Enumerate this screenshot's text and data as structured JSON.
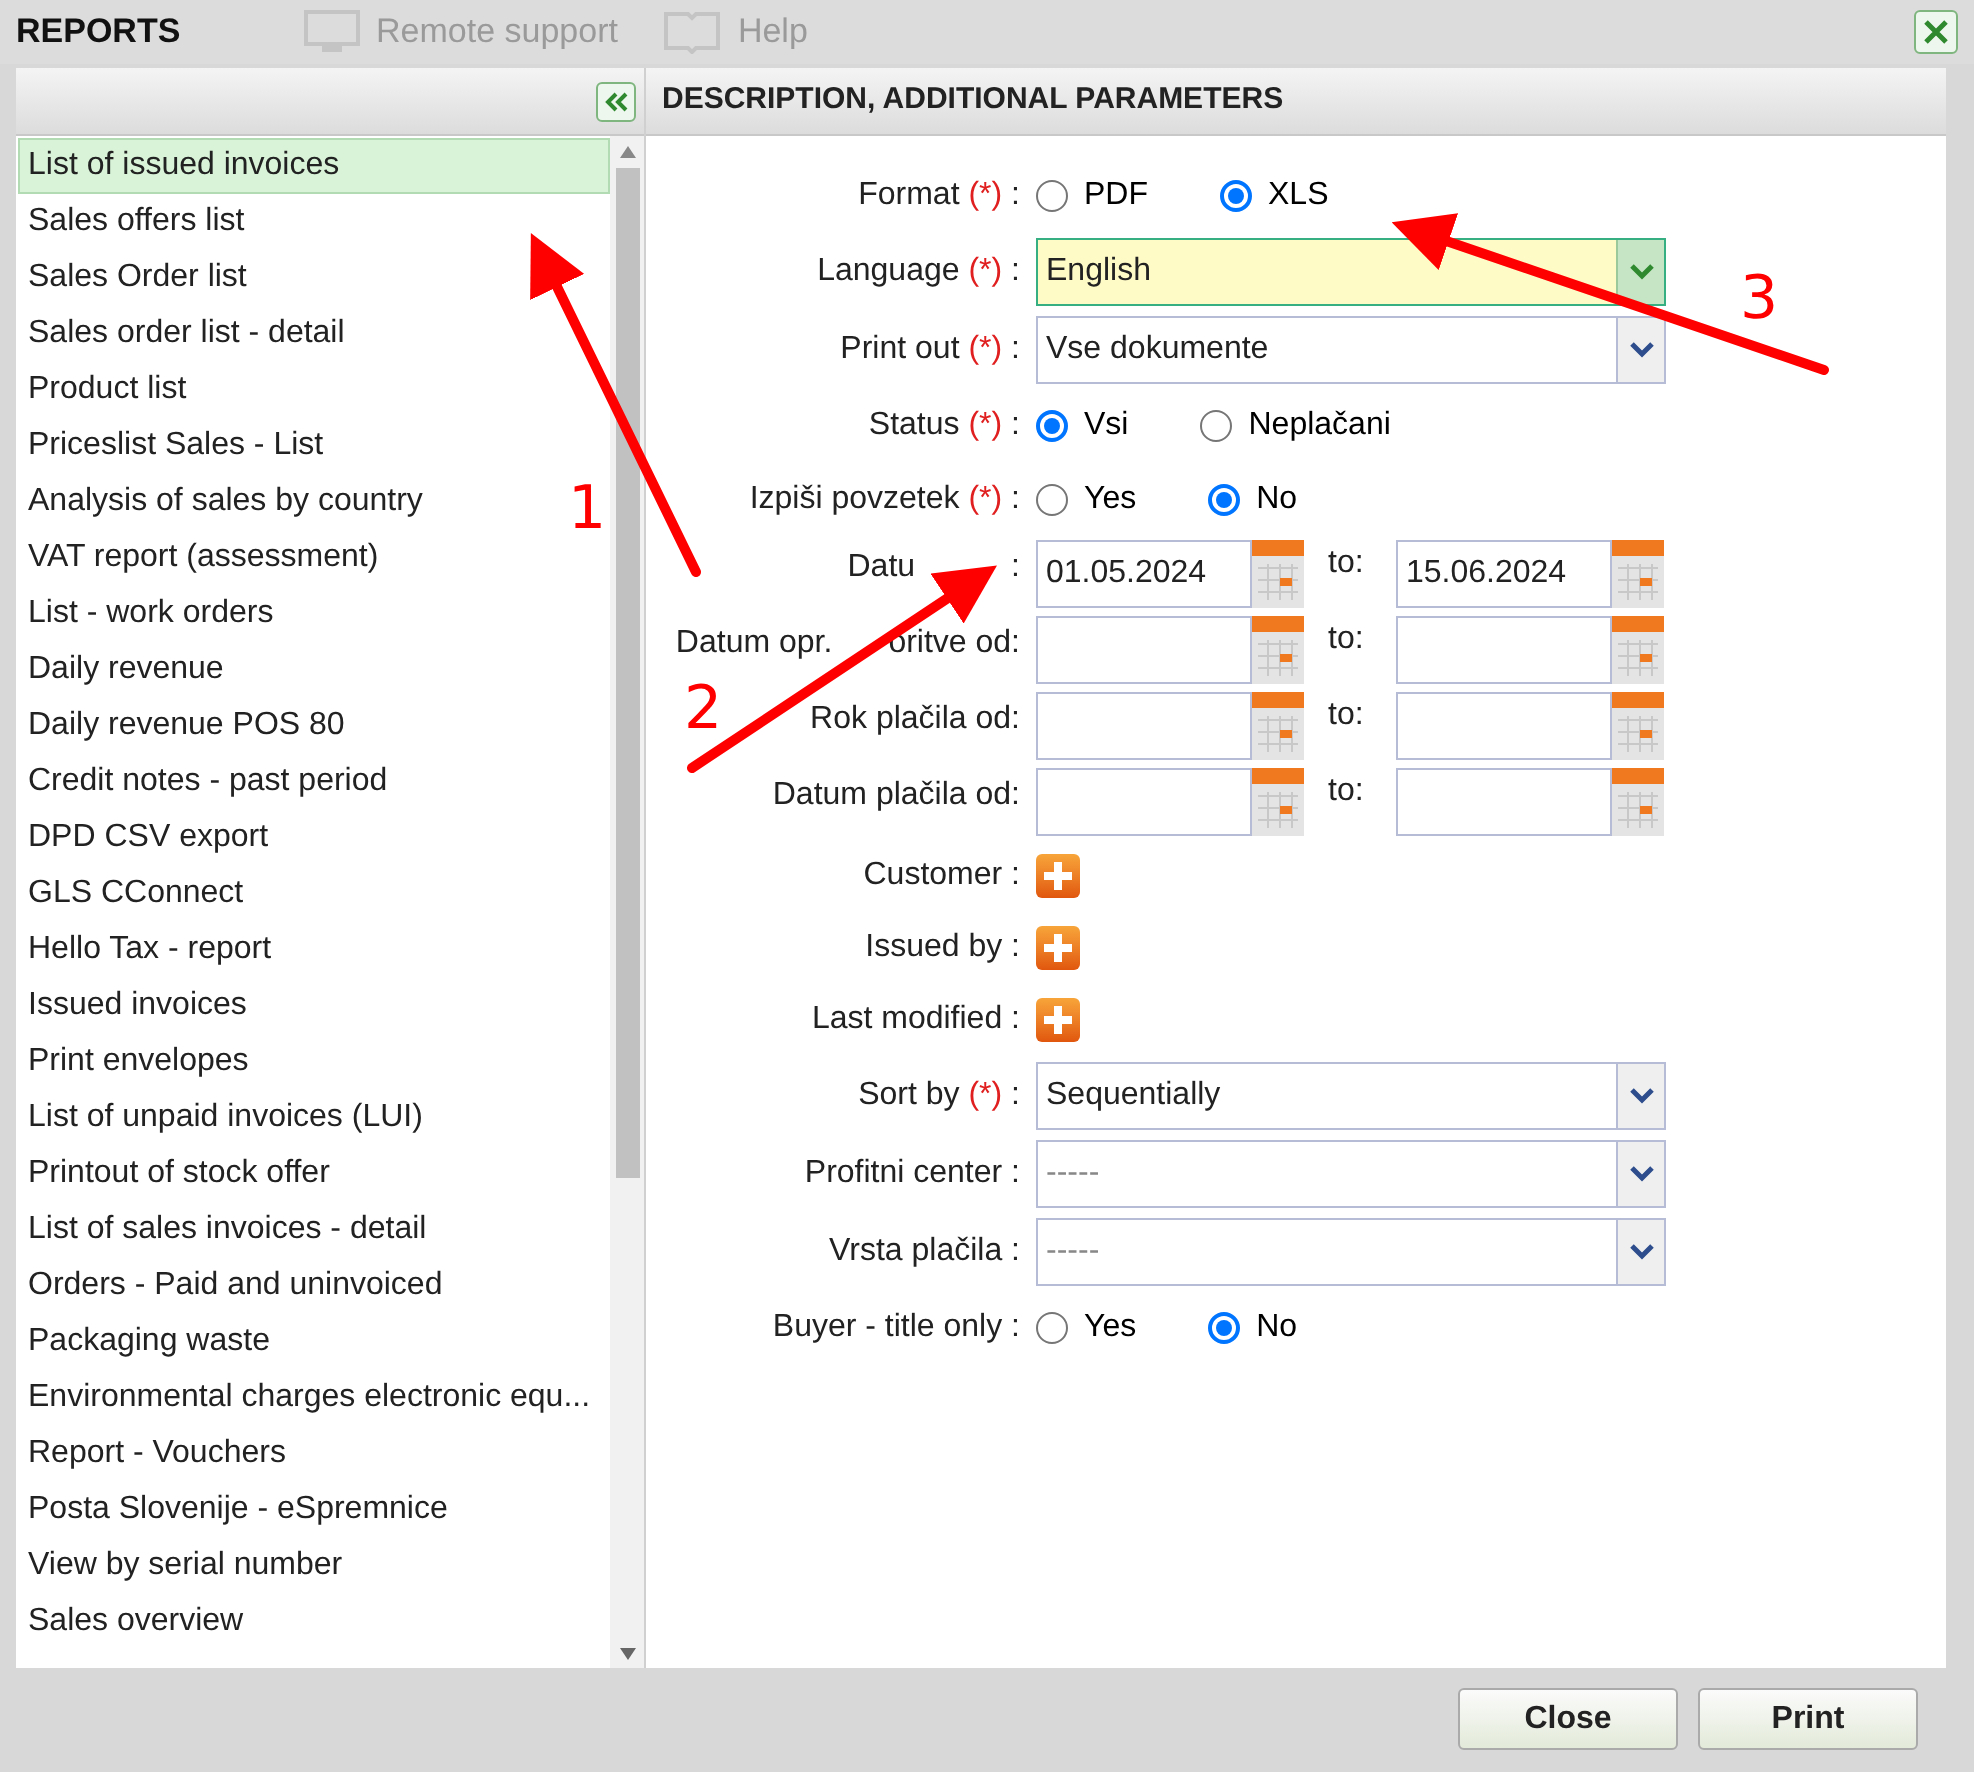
{
  "background_toolbar": [
    "Remote support",
    "Help"
  ],
  "dialog": {
    "title": "REPORTS"
  },
  "reports_panel": {
    "items": [
      {
        "label": "List of issued invoices",
        "selected": true
      },
      {
        "label": "Sales offers list",
        "selected": false
      },
      {
        "label": "Sales Order list",
        "selected": false
      },
      {
        "label": "Sales order list - detail",
        "selected": false
      },
      {
        "label": "Product list",
        "selected": false
      },
      {
        "label": "Priceslist Sales - List",
        "selected": false
      },
      {
        "label": "Analysis of sales by country",
        "selected": false
      },
      {
        "label": "VAT report (assessment)",
        "selected": false
      },
      {
        "label": "List - work orders",
        "selected": false
      },
      {
        "label": "Daily revenue",
        "selected": false
      },
      {
        "label": "Daily revenue POS 80",
        "selected": false
      },
      {
        "label": "Credit notes - past period",
        "selected": false
      },
      {
        "label": "DPD CSV export",
        "selected": false
      },
      {
        "label": "GLS CConnect",
        "selected": false
      },
      {
        "label": "Hello Tax - report",
        "selected": false
      },
      {
        "label": "Issued invoices",
        "selected": false
      },
      {
        "label": "Print envelopes",
        "selected": false
      },
      {
        "label": "List of unpaid invoices (LUI)",
        "selected": false
      },
      {
        "label": "Printout of stock offer",
        "selected": false
      },
      {
        "label": "List of sales invoices - detail",
        "selected": false
      },
      {
        "label": "Orders - Paid and uninvoiced",
        "selected": false
      },
      {
        "label": "Packaging waste",
        "selected": false
      },
      {
        "label": "Environmental charges electronic equ...",
        "selected": false
      },
      {
        "label": "Report - Vouchers",
        "selected": false
      },
      {
        "label": "Posta Slovenije - eSpremnice",
        "selected": false
      },
      {
        "label": "View by serial number",
        "selected": false
      },
      {
        "label": "Sales overview",
        "selected": false
      }
    ]
  },
  "parameters_panel": {
    "title": "DESCRIPTION, ADDITIONAL PARAMETERS",
    "fields": [
      {
        "kind": "radio",
        "label": "Format",
        "required": "(*)",
        "suffix": ":",
        "options": [
          {
            "label": "PDF",
            "selected": false
          },
          {
            "label": "XLS",
            "selected": true
          }
        ]
      },
      {
        "kind": "select",
        "label": "Language",
        "required": "(*)",
        "suffix": ":",
        "value": "English",
        "highlighted": true
      },
      {
        "kind": "select",
        "label": "Print out",
        "required": "(*)",
        "suffix": ":",
        "value": "Vse dokumente",
        "highlighted": false
      },
      {
        "kind": "radio",
        "label": "Status",
        "required": "(*)",
        "suffix": ":",
        "options": [
          {
            "label": "Vsi",
            "selected": true
          },
          {
            "label": "Neplačani",
            "selected": false
          }
        ]
      },
      {
        "kind": "radio",
        "label": "Izpiši povzetek",
        "required": "(*)",
        "suffix": ":",
        "options": [
          {
            "label": "Yes",
            "selected": false
          },
          {
            "label": "No",
            "selected": true
          }
        ]
      },
      {
        "kind": "daterange",
        "label": "Datu",
        "label_tail": ":",
        "from": "01.05.2024",
        "to_label": "to:",
        "to": "15.06.2024"
      },
      {
        "kind": "daterange",
        "label": "Datum opr.",
        "label_tail": "oritve od:",
        "to_label": "to:"
      },
      {
        "kind": "daterange",
        "label": "Rok plačila od:",
        "to_label": "to:"
      },
      {
        "kind": "daterange",
        "label": "Datum plačila od:",
        "to_label": "to:"
      },
      {
        "kind": "add",
        "label": "Customer",
        "suffix": ":"
      },
      {
        "kind": "add",
        "label": "Issued by",
        "suffix": ":"
      },
      {
        "kind": "add",
        "label": "Last modified",
        "suffix": ":"
      },
      {
        "kind": "select",
        "label": "Sort by",
        "required": "(*)",
        "suffix": ":",
        "value": "Sequentially",
        "highlighted": false
      },
      {
        "kind": "select",
        "label": "Profitni center",
        "suffix": ":",
        "placeholder": "-----",
        "highlighted": false
      },
      {
        "kind": "select",
        "label": "Vrsta plačila",
        "suffix": ":",
        "placeholder": "-----",
        "highlighted": false
      },
      {
        "kind": "radio",
        "label": "Buyer - title only",
        "suffix": ":",
        "options": [
          {
            "label": "Yes",
            "selected": false
          },
          {
            "label": "No",
            "selected": true
          }
        ]
      }
    ]
  },
  "buttons": [
    "Close",
    "Print"
  ],
  "annotations": [
    {
      "label": "1"
    },
    {
      "label": "2"
    },
    {
      "label": "3"
    }
  ]
}
